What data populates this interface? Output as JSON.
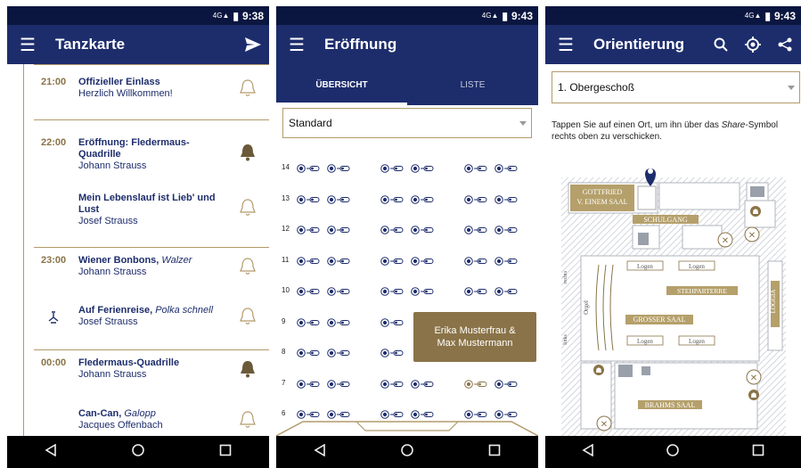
{
  "screen1": {
    "status_time": "9:38",
    "title": "Tanzkarte",
    "entries": [
      {
        "time": "21:00",
        "title": "Offizieller Einlass",
        "style": "",
        "composer": "Herzlich Willkommen!",
        "bell": "outline"
      },
      {
        "time": "22:00",
        "title": "Eröffnung: Fledermaus-Quadrille",
        "style": "",
        "composer": "Johann Strauss",
        "bell": "filled"
      },
      {
        "time": "",
        "title": "Mein Lebenslauf ist Lieb' und Lust",
        "style": "",
        "composer": "Josef Strauss",
        "bell": "outline"
      },
      {
        "time": "23:00",
        "title": "Wiener Bonbons,",
        "style": "Walzer",
        "composer": "Johann Strauss",
        "bell": "outline"
      },
      {
        "time": "",
        "title": "Auf Ferienreise,",
        "style": "Polka schnell",
        "composer": "Josef Strauss",
        "bell": "outline"
      },
      {
        "time": "00:00",
        "title": "Fledermaus-Quadrille",
        "style": "",
        "composer": "Johann Strauss",
        "bell": "filled"
      },
      {
        "time": "",
        "title": "Can-Can,",
        "style": "Galopp",
        "composer": "Jacques Offenbach",
        "bell": "outline"
      }
    ]
  },
  "screen2": {
    "status_time": "9:43",
    "title": "Eröffnung",
    "tabs": [
      "ÜBERSICHT",
      "LISTE"
    ],
    "select_value": "Standard",
    "rows": [
      "14",
      "13",
      "12",
      "11",
      "10",
      "9",
      "8",
      "7",
      "6"
    ],
    "tooltip_line1": "Erika Musterfrau &",
    "tooltip_line2": "Max Mustermann"
  },
  "screen3": {
    "status_time": "9:43",
    "title": "Orientierung",
    "select_value": "1. Obergeschoß",
    "hint_before": "Tappen Sie auf einen Ort, um ihn über das ",
    "hint_em": "Share",
    "hint_after": "-Symbol rechts oben zu verschicken.",
    "rooms": {
      "gottfried_1": "GOTTFRIED",
      "gottfried_2": "V. EINEM SAAL",
      "schulgang": "SCHULGANG",
      "logen_1": "Logen",
      "logen_2": "Logen",
      "logen_3": "Logen",
      "logen_4": "Logen",
      "stehparterre": "STEHPARTERRE",
      "grosser_saal": "GROSSER SAAL",
      "loggia": "LOGGIA",
      "orgel": "Orgel",
      "rechts": "rechts",
      "links": "links",
      "brahms_saal": "BRAHMS SAAL"
    }
  },
  "colors": {
    "appbar": "#1d2d6c",
    "statusbar": "#0b1640",
    "gold": "#b39a6a",
    "tooltip": "#8a7348"
  }
}
